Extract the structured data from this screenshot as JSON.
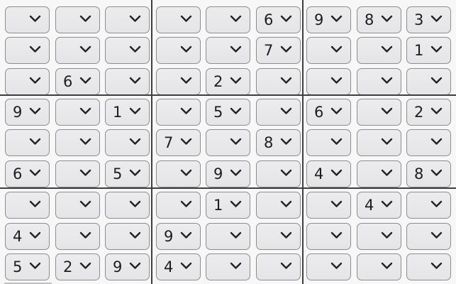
{
  "sudoku": {
    "rows": [
      [
        "",
        "",
        "",
        "",
        "",
        "6",
        "9",
        "8",
        "3"
      ],
      [
        "",
        "",
        "",
        "",
        "",
        "7",
        "",
        "",
        "1"
      ],
      [
        "",
        "6",
        "",
        "",
        "2",
        "",
        "",
        "",
        ""
      ],
      [
        "9",
        "",
        "1",
        "",
        "5",
        "",
        "6",
        "",
        "2"
      ],
      [
        "",
        "",
        "",
        "7",
        "",
        "8",
        "",
        "",
        ""
      ],
      [
        "6",
        "",
        "5",
        "",
        "9",
        "",
        "4",
        "",
        "8"
      ],
      [
        "",
        "",
        "",
        "",
        "1",
        "",
        "",
        "4",
        ""
      ],
      [
        "4",
        "",
        "",
        "9",
        "",
        "",
        "",
        "",
        ""
      ],
      [
        "5",
        "2",
        "9",
        "4",
        "",
        "",
        "",
        "",
        ""
      ]
    ]
  },
  "icons": {
    "dropdown": "chevron-down-icon"
  },
  "colors": {
    "cell_bg": "#e8e8eb",
    "cell_border": "#8d8d8d",
    "box_divider": "#3e3e3e",
    "text": "#1d1d1d"
  }
}
